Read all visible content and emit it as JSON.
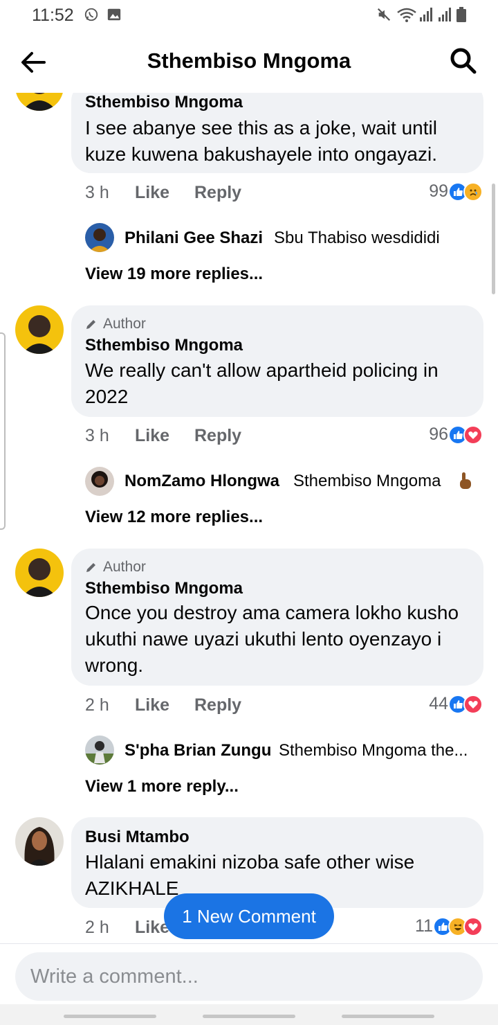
{
  "status_bar": {
    "time": "11:52"
  },
  "header": {
    "title": "Sthembiso Mngoma"
  },
  "comments": [
    {
      "author": "Sthembiso Mngoma",
      "text": "I see abanye see this as a joke, wait until kuze kuwena bakushayele into ongayazi.",
      "time": "3 h",
      "like": "Like",
      "reply": "Reply",
      "reaction_count": "99",
      "reactions": [
        "like",
        "sad"
      ],
      "reply_preview": {
        "name": "Philani Gee Shazi",
        "text": "Sbu Thabiso wesdididi"
      },
      "view_more": "View 19 more replies..."
    },
    {
      "badge": "Author",
      "author": "Sthembiso Mngoma",
      "text": "We really can't allow apartheid policing in 2022",
      "time": "3 h",
      "like": "Like",
      "reply": "Reply",
      "reaction_count": "96",
      "reactions": [
        "like",
        "love"
      ],
      "reply_preview": {
        "name": "NomZamo Hlongwa",
        "text": "Sthembiso Mngoma"
      },
      "view_more": "View 12 more replies..."
    },
    {
      "badge": "Author",
      "author": "Sthembiso Mngoma",
      "text": "Once you destroy ama camera lokho kusho ukuthi nawe uyazi ukuthi lento oyenzayo i wrong.",
      "time": "2 h",
      "like": "Like",
      "reply": "Reply",
      "reaction_count": "44",
      "reactions": [
        "like",
        "love"
      ],
      "reply_preview": {
        "name": "S'pha Brian Zungu",
        "text": "Sthembiso Mngoma the..."
      },
      "view_more": "View 1 more reply..."
    },
    {
      "author": "Busi Mtambo",
      "text": "Hlalani emakini nizoba safe other wise AZIKHALE",
      "time": "2 h",
      "like": "Like",
      "reaction_count": "11",
      "reactions": [
        "like",
        "haha",
        "love"
      ]
    }
  ],
  "new_comment_pill": "1 New Comment",
  "composer": {
    "placeholder": "Write a comment..."
  },
  "colors": {
    "like": "#1877f2",
    "love": "#f33e58",
    "haha": "#f7b125",
    "accent": "#1b74e4"
  }
}
